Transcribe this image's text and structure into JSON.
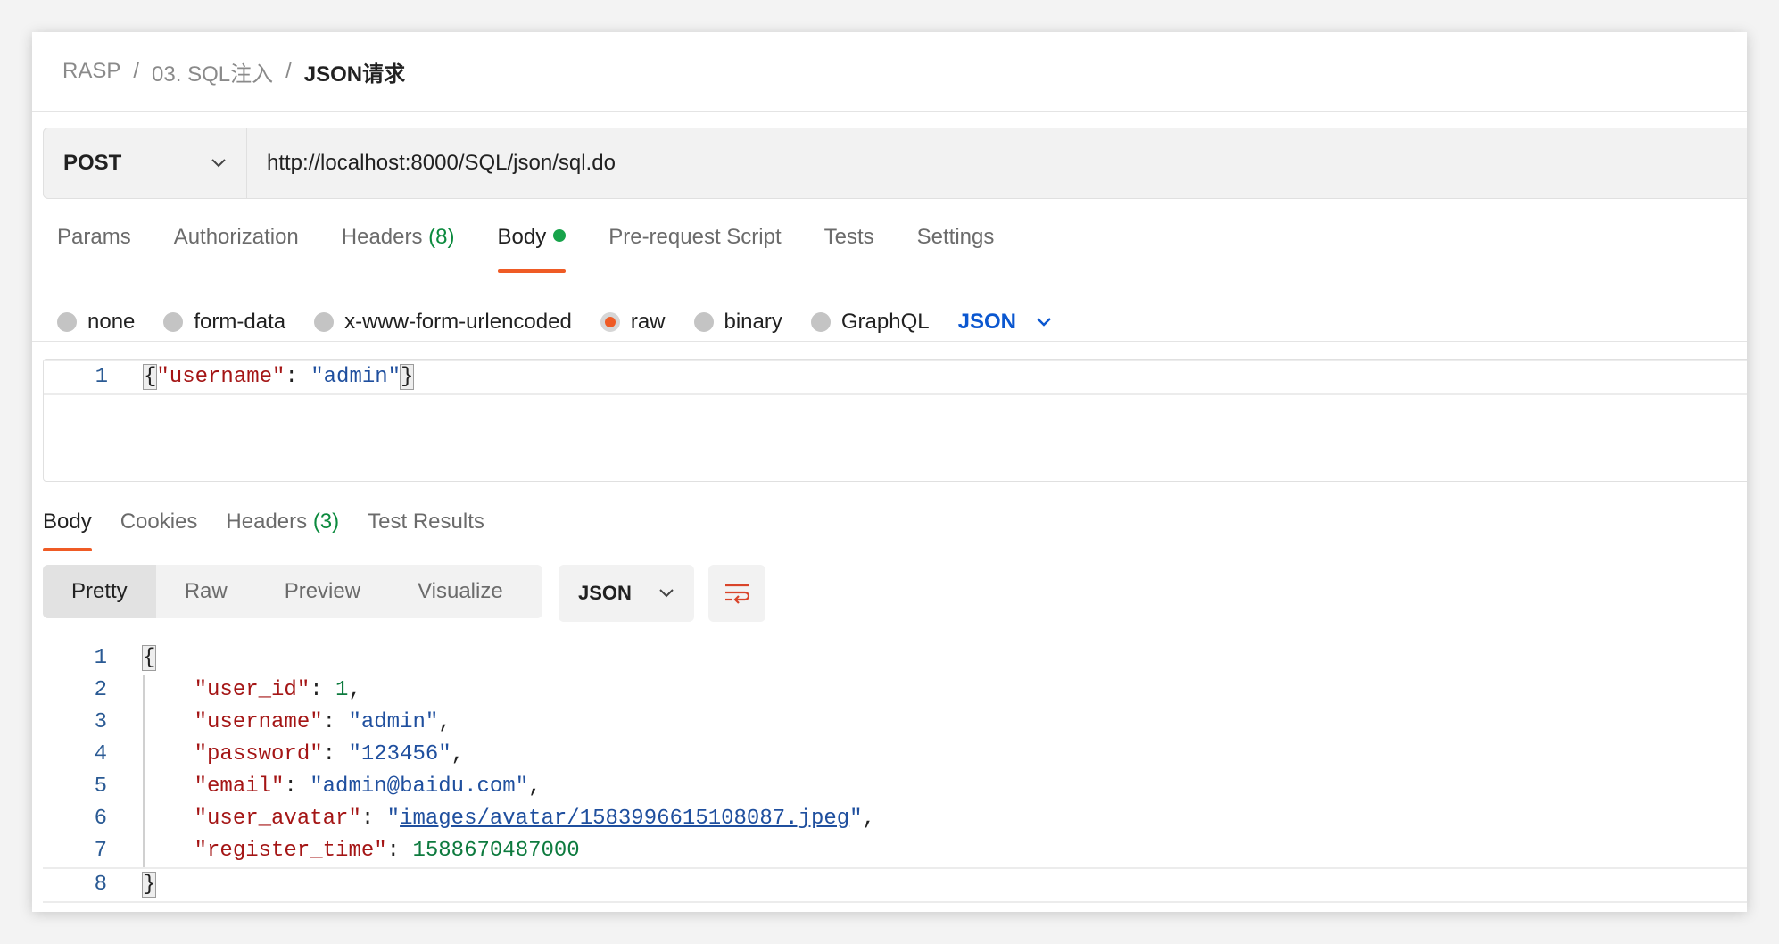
{
  "breadcrumb": [
    "RASP",
    "03. SQL注入",
    "JSON请求"
  ],
  "breadcrumb_sep": "/",
  "request": {
    "method": "POST",
    "url": "http://localhost:8000/SQL/json/sql.do"
  },
  "request_tabs": {
    "params": "Params",
    "authorization": "Authorization",
    "headers": "Headers",
    "headers_count": "(8)",
    "body": "Body",
    "prerequest": "Pre-request Script",
    "tests": "Tests",
    "settings": "Settings"
  },
  "body_types": {
    "none": "none",
    "form_data": "form-data",
    "urlencoded": "x-www-form-urlencoded",
    "raw": "raw",
    "binary": "binary",
    "graphql": "GraphQL",
    "selected": "raw",
    "language": "JSON"
  },
  "request_body": {
    "line_number": "1",
    "open": "{",
    "key": "\"username\"",
    "colon": ": ",
    "value": "\"admin\"",
    "close": "}"
  },
  "response_tabs": {
    "body": "Body",
    "cookies": "Cookies",
    "headers": "Headers",
    "headers_count": "(3)",
    "test_results": "Test Results"
  },
  "response_view": {
    "pretty": "Pretty",
    "raw": "Raw",
    "preview": "Preview",
    "visualize": "Visualize",
    "format": "JSON",
    "wrap_icon": "wrap-lines-icon"
  },
  "response_body": {
    "open": "{",
    "close": "}",
    "lines": [
      {
        "n": "1"
      },
      {
        "n": "2",
        "key": "\"user_id\"",
        "value": "1",
        "type": "num",
        "comma": ","
      },
      {
        "n": "3",
        "key": "\"username\"",
        "value": "\"admin\"",
        "type": "str",
        "comma": ","
      },
      {
        "n": "4",
        "key": "\"password\"",
        "value": "\"123456\"",
        "type": "str",
        "comma": ","
      },
      {
        "n": "5",
        "key": "\"email\"",
        "value": "\"admin@baidu.com\"",
        "type": "str",
        "comma": ","
      },
      {
        "n": "6",
        "key": "\"user_avatar\"",
        "value_quote": "\"",
        "value_link": "images/avatar/1583996615108087.jpeg",
        "type": "str",
        "comma": ","
      },
      {
        "n": "7",
        "key": "\"register_time\"",
        "value": "1588670487000",
        "type": "num",
        "comma": ""
      },
      {
        "n": "8"
      }
    ]
  },
  "colors": {
    "accent": "#ef5b25",
    "count_green": "#0c8a3e",
    "body_dot": "#17a34a",
    "json_key": "#a41515",
    "json_string": "#1f4f9e",
    "json_number": "#0d7a3e",
    "lang_blue": "#0b57d0"
  }
}
